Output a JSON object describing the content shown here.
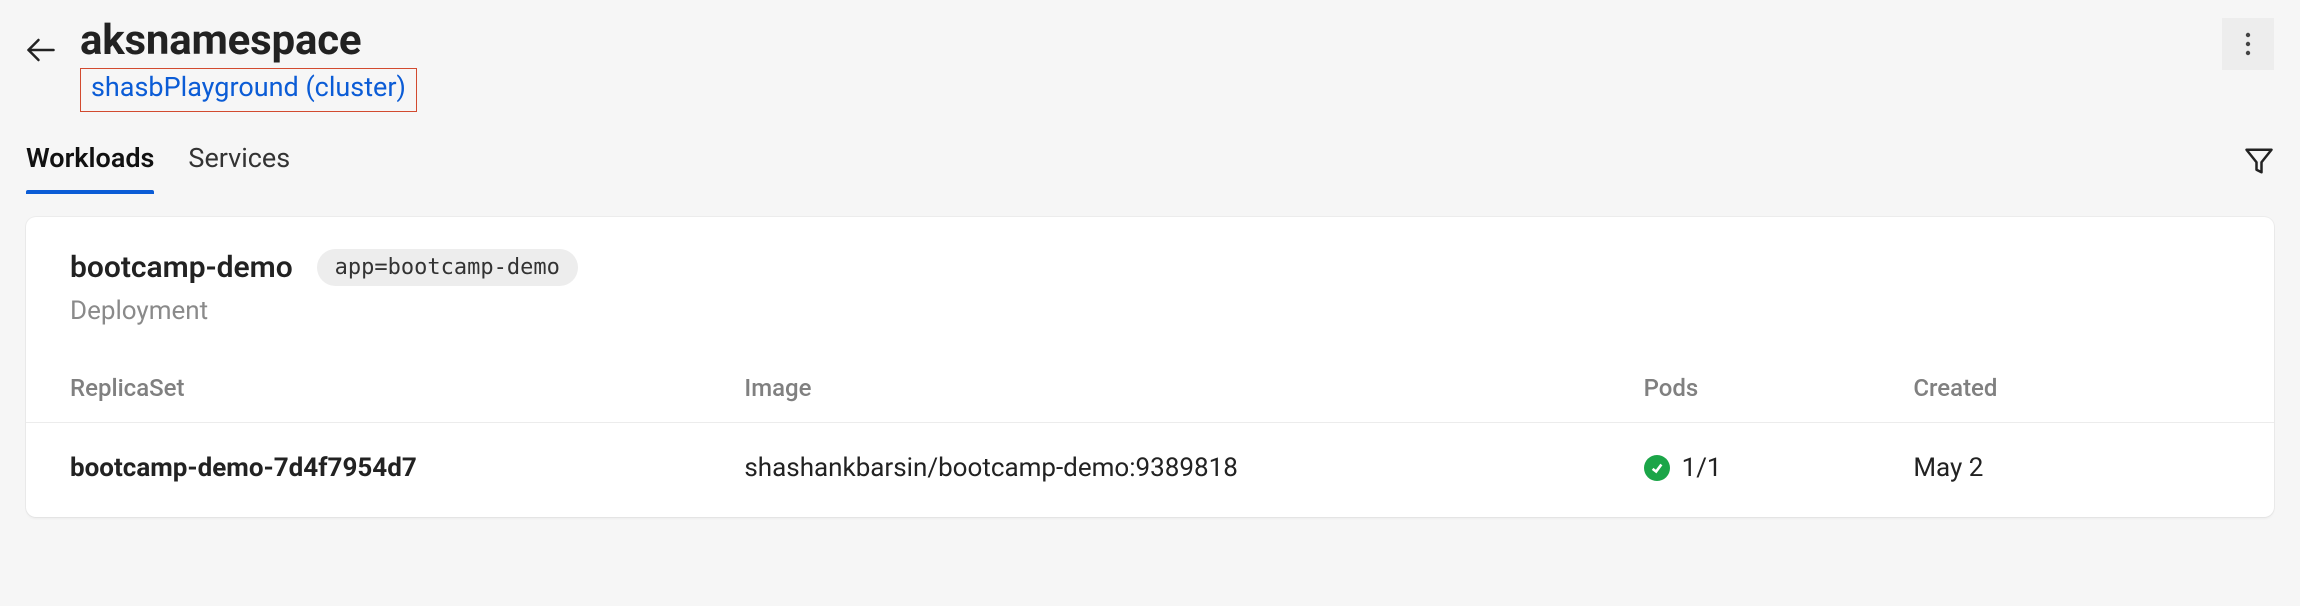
{
  "header": {
    "title": "aksnamespace",
    "cluster_link": "shasbPlayground (cluster)"
  },
  "tabs": [
    {
      "label": "Workloads",
      "active": true
    },
    {
      "label": "Services",
      "active": false
    }
  ],
  "deployment": {
    "name": "bootcamp-demo",
    "chip": "app=bootcamp-demo",
    "kind": "Deployment",
    "columns": {
      "replicaset": "ReplicaSet",
      "image": "Image",
      "pods": "Pods",
      "created": "Created"
    },
    "rows": [
      {
        "name": "bootcamp-demo-7d4f7954d7",
        "image": "shashankbarsin/bootcamp-demo:9389818",
        "pods_status": "ok",
        "pods": "1/1",
        "created": "May 2"
      }
    ]
  }
}
